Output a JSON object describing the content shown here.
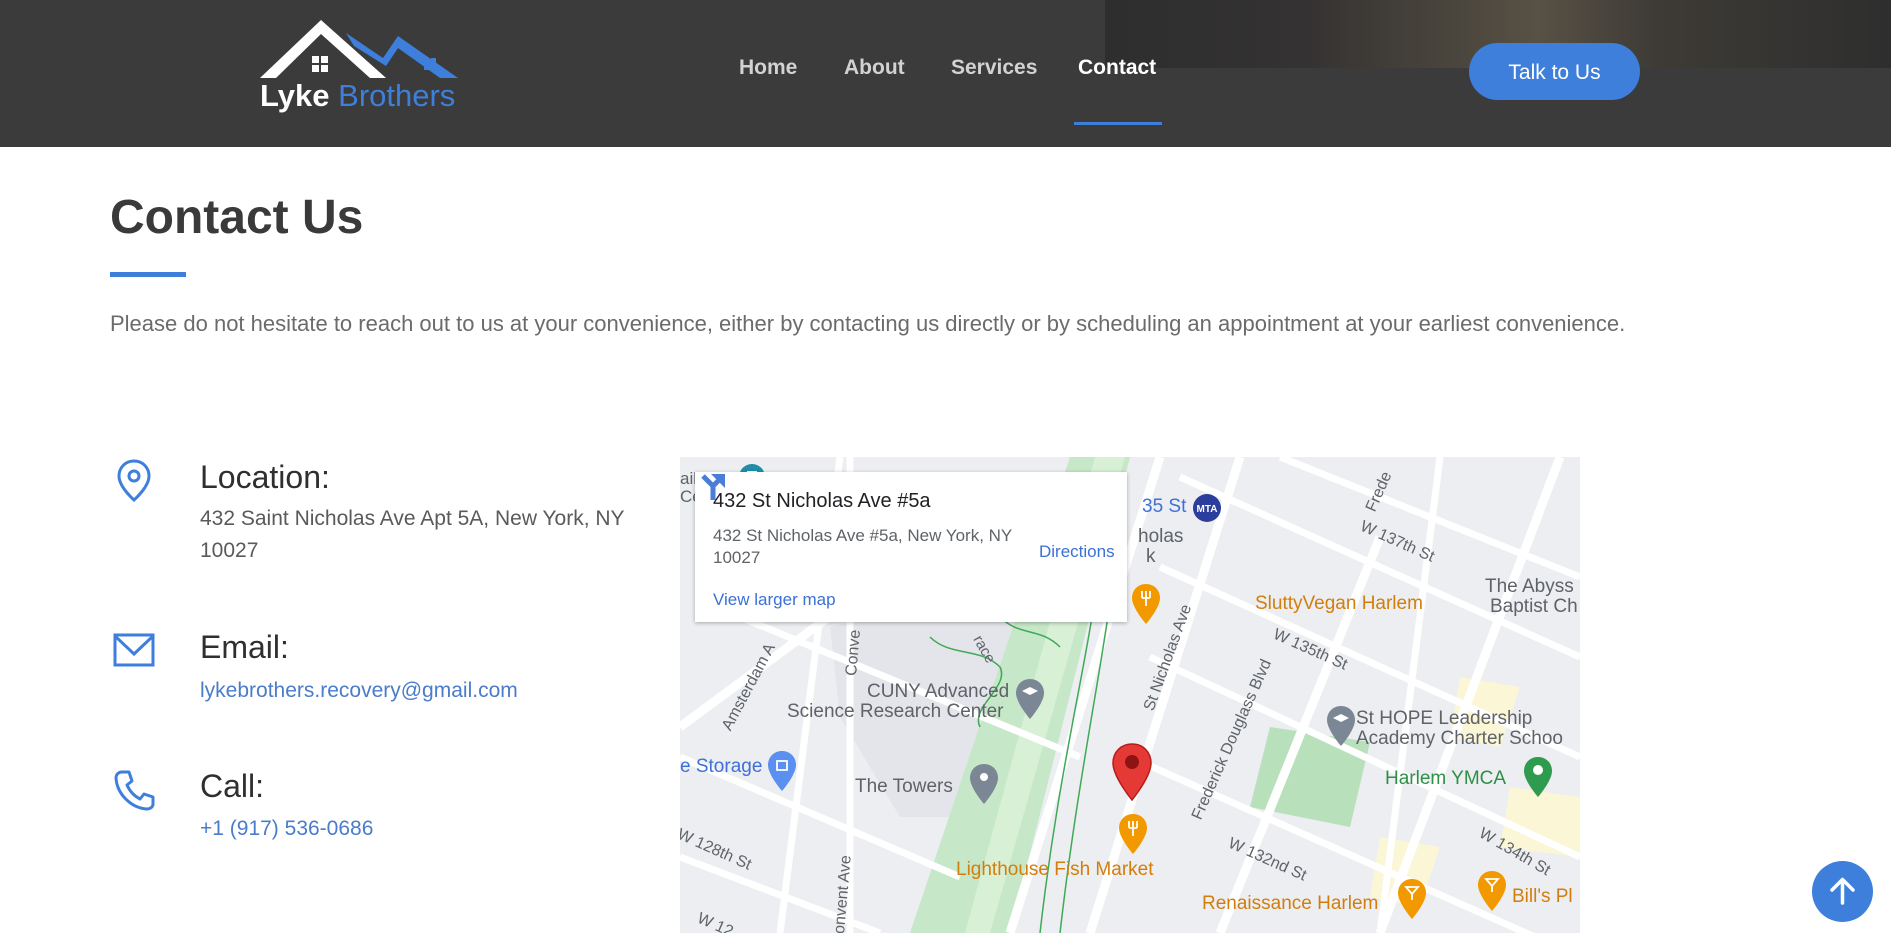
{
  "header": {
    "logo": {
      "word1": "Lyke",
      "word2": "Brothers"
    },
    "nav": [
      {
        "label": "Home"
      },
      {
        "label": "About"
      },
      {
        "label": "Services"
      },
      {
        "label": "Contact",
        "active": true
      }
    ],
    "cta_label": "Talk to Us"
  },
  "main": {
    "title": "Contact Us",
    "intro": "Please do not hesitate to reach out to us at your convenience, either by contacting us directly or by scheduling an appointment at your earliest convenience.",
    "location": {
      "heading": "Location:",
      "text": "432 Saint Nicholas Ave Apt 5A, New York, NY 10027",
      "icon": "location-pin-icon"
    },
    "email": {
      "heading": "Email:",
      "text": "lykebrothers.recovery@gmail.com",
      "icon": "envelope-icon"
    },
    "call": {
      "heading": "Call:",
      "text": "+1 (917) 536-0686",
      "icon": "phone-icon"
    }
  },
  "map": {
    "card": {
      "title": "432 St Nicholas Ave #5a",
      "address": "432 St Nicholas Ave #5a, New York, NY 10027",
      "directions": "Directions",
      "larger_map": "View larger map"
    },
    "labels": {
      "sluttyvegan": "SluttyVegan Harlem",
      "abyss1": "The Abyss",
      "abyss2": "Baptist Ch",
      "st_hope1": "St HOPE Leadership",
      "st_hope2": "Academy Charter Schoo",
      "harlem_ymca": "Harlem YMCA",
      "cuny1": "CUNY Advanced",
      "cuny2": "Science Research Center",
      "storage": "e Storage",
      "towers": "The Towers",
      "lighthouse": "Lighthouse Fish Market",
      "renaissance": "Renaissance Harlem",
      "bills": "Bill's Pl",
      "station": "35 St",
      "nicholas": "holas",
      "park_k": "k",
      "mta": "MTA",
      "street_137": "W 137th St",
      "street_135": "W 135th St",
      "street_132": "W 132nd St",
      "street_134": "W 134th St",
      "street_128": "W 128th St",
      "street_12x": "W 12",
      "st_nicholas_ave": "St Nicholas Ave",
      "frederick_douglass": "Frederick Douglass Blvd",
      "amsterdam": "Amsterdam A",
      "convent_top": "Conve",
      "convent_bottom": "onvent Ave",
      "frede": "Frede",
      "terrace": "race",
      "edge_top1": "ail",
      "edge_top2": "Ce"
    }
  },
  "colors": {
    "header_bg": "#3b3b3b",
    "accent": "#3d7fdb",
    "title": "#3a3a3a",
    "body_text": "#6b6b6b",
    "link": "#4a7cc9"
  }
}
